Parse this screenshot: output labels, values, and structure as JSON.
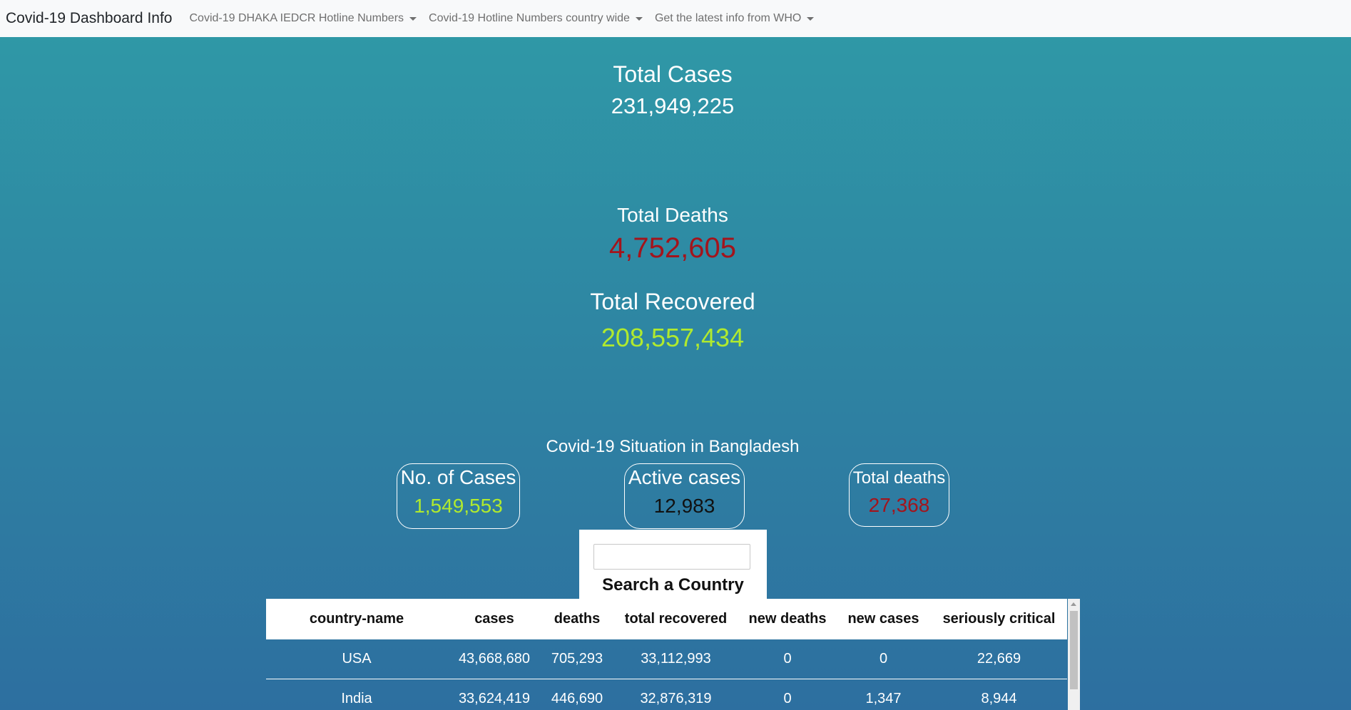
{
  "navbar": {
    "brand": "Covid-19 Dashboard Info",
    "items": [
      {
        "label": "Covid-19 DHAKA IEDCR Hotline Numbers"
      },
      {
        "label": "Covid-19 Hotline Numbers country wide"
      },
      {
        "label": "Get the latest info from WHO"
      }
    ]
  },
  "global": {
    "cases_label": "Total Cases",
    "cases_value": "231,949,225",
    "deaths_label": "Total Deaths",
    "deaths_value": "4,752,605",
    "recovered_label": "Total Recovered",
    "recovered_value": "208,557,434"
  },
  "bangladesh": {
    "title": "Covid-19 Situation in Bangladesh",
    "cases_label": "No. of Cases",
    "cases_value": "1,549,553",
    "active_label": "Active cases",
    "active_value": "12,983",
    "deaths_label": "Total deaths",
    "deaths_value": "27,368"
  },
  "search": {
    "label": "Search a Country",
    "value": ""
  },
  "table": {
    "headers": [
      "country-name",
      "cases",
      "deaths",
      "total recovered",
      "new deaths",
      "new cases",
      "seriously critical"
    ],
    "rows": [
      [
        "USA",
        "43,668,680",
        "705,293",
        "33,112,993",
        "0",
        "0",
        "22,669"
      ],
      [
        "India",
        "33,624,419",
        "446,690",
        "32,876,319",
        "0",
        "1,347",
        "8,944"
      ]
    ]
  },
  "colors": {
    "deaths": "#a3141c",
    "recovered": "#b0ea2e",
    "background_top": "#2f9aa7",
    "background_bottom": "#2d6fa0"
  }
}
